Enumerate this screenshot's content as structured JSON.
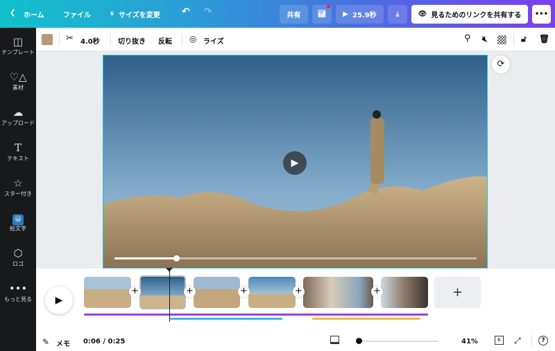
{
  "topbar": {
    "home": "ホーム",
    "file": "ファイル",
    "resize": "サイズを変更",
    "share": "共有",
    "duration": "25.9秒",
    "share_link": "見るためのリンクを共有する",
    "more": "•••"
  },
  "sidebar": [
    {
      "label": "テンプレート",
      "icon": "layout-icon"
    },
    {
      "label": "素材",
      "icon": "elements-icon"
    },
    {
      "label": "アップロード",
      "icon": "upload-icon"
    },
    {
      "label": "テキスト",
      "icon": "text-icon"
    },
    {
      "label": "スター付き",
      "icon": "star-icon"
    },
    {
      "label": "絵文字",
      "icon": "emoji-icon"
    },
    {
      "label": "ロゴ",
      "icon": "logo-icon"
    },
    {
      "label": "もっと見る",
      "icon": "more-icon"
    }
  ],
  "toolbar": {
    "color": "#b59a76",
    "time": "4.0秒",
    "crop": "切り抜き",
    "flip": "反転",
    "rise": "ライズ"
  },
  "video": {
    "progress": 0.17
  },
  "timeline": {
    "add": "+",
    "clip_count": "6"
  },
  "footer": {
    "notes": "メモ",
    "time": "0:06 / 0:25",
    "zoom": "41%",
    "zoom_level": 0.02,
    "help": "?"
  }
}
